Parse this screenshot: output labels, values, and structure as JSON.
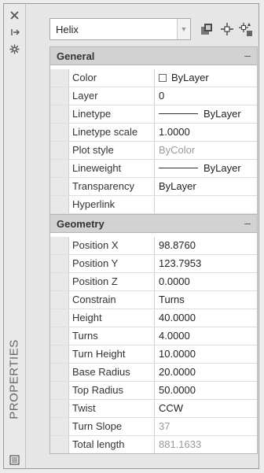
{
  "side_strip": {
    "close_icon": "close-icon",
    "autohide_icon": "autohide-icon",
    "settings_icon": "settings-icon",
    "title": "PROPERTIES",
    "bottom_icon": "properties-icon"
  },
  "toolbar": {
    "object_type": "Helix",
    "buttons": [
      "toggle-pickadd-icon",
      "select-objects-icon",
      "quick-select-icon"
    ]
  },
  "sections": {
    "general": {
      "title": "General",
      "toggle": "–",
      "rows": [
        {
          "name": "Color",
          "value": "ByLayer"
        },
        {
          "name": "Layer",
          "value": "0"
        },
        {
          "name": "Linetype",
          "value": "ByLayer"
        },
        {
          "name": "Linetype scale",
          "value": "1.0000"
        },
        {
          "name": "Plot style",
          "value": "ByColor"
        },
        {
          "name": "Lineweight",
          "value": "ByLayer"
        },
        {
          "name": "Transparency",
          "value": "ByLayer"
        },
        {
          "name": "Hyperlink",
          "value": ""
        }
      ]
    },
    "geometry": {
      "title": "Geometry",
      "toggle": "–",
      "rows": [
        {
          "name": "Position X",
          "value": "98.8760"
        },
        {
          "name": "Position Y",
          "value": "123.7953"
        },
        {
          "name": "Position Z",
          "value": "0.0000"
        },
        {
          "name": "Constrain",
          "value": "Turns"
        },
        {
          "name": "Height",
          "value": "40.0000"
        },
        {
          "name": "Turns",
          "value": "4.0000"
        },
        {
          "name": "Turn Height",
          "value": "10.0000"
        },
        {
          "name": "Base Radius",
          "value": "20.0000"
        },
        {
          "name": "Top Radius",
          "value": "50.0000"
        },
        {
          "name": "Twist",
          "value": "CCW"
        },
        {
          "name": "Turn Slope",
          "value": "37"
        },
        {
          "name": "Total length",
          "value": "881.1633"
        }
      ]
    }
  }
}
